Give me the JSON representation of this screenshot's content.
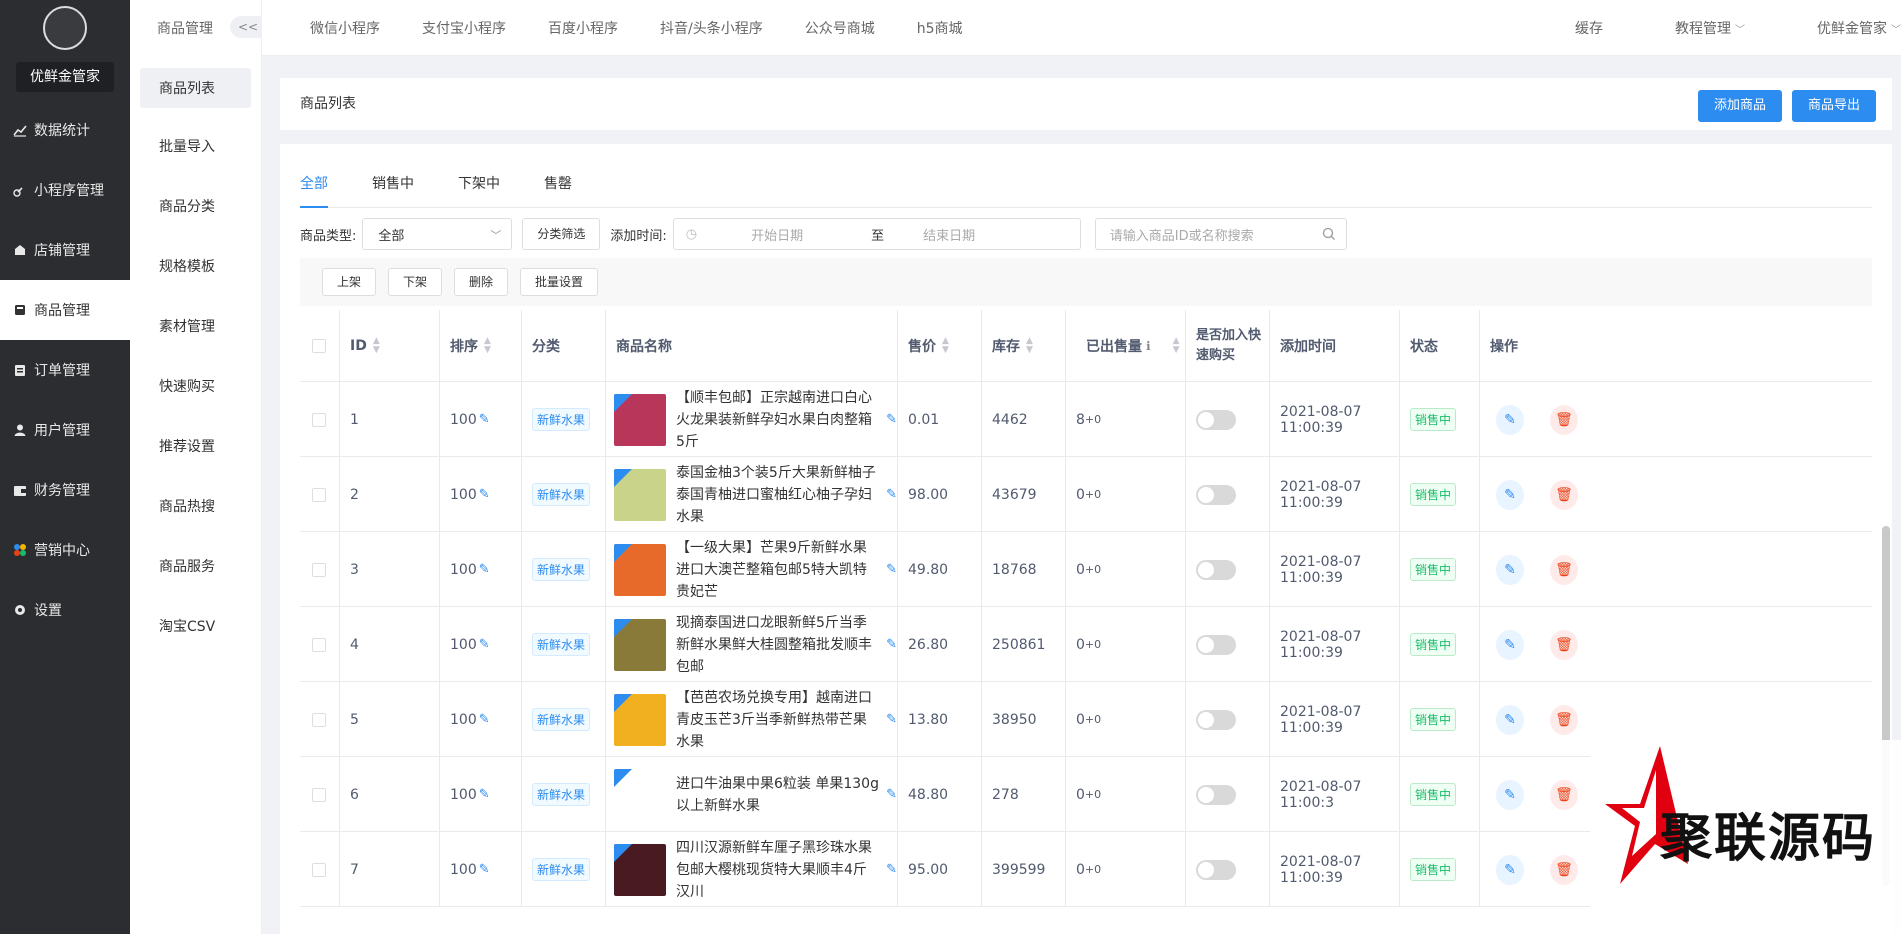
{
  "sidebar": {
    "brand": "优鲜金管家",
    "items": [
      {
        "icon": "chart-line-icon",
        "label": "数据统计"
      },
      {
        "icon": "link-icon",
        "label": "小程序管理"
      },
      {
        "icon": "store-icon",
        "label": "店铺管理"
      },
      {
        "icon": "box-icon",
        "label": "商品管理"
      },
      {
        "icon": "clipboard-icon",
        "label": "订单管理"
      },
      {
        "icon": "user-icon",
        "label": "用户管理"
      },
      {
        "icon": "wallet-icon",
        "label": "财务管理"
      },
      {
        "icon": "marketing-icon",
        "label": "营销中心"
      },
      {
        "icon": "gear-icon",
        "label": "设置"
      }
    ]
  },
  "subsidebar": {
    "title": "商品管理",
    "collapse_label": "<<",
    "items": [
      "商品列表",
      "批量导入",
      "商品分类",
      "规格模板",
      "素材管理",
      "快速购买",
      "推荐设置",
      "商品热搜",
      "商品服务",
      "淘宝CSV"
    ]
  },
  "topbar": {
    "tabs": [
      "微信小程序",
      "支付宝小程序",
      "百度小程序",
      "抖音/头条小程序",
      "公众号商城",
      "h5商城"
    ],
    "right": {
      "cache": "缓存",
      "tutorial": "教程管理",
      "user": "优鲜金管家"
    }
  },
  "header": {
    "title": "商品列表",
    "add_label": "添加商品",
    "export_label": "商品导出"
  },
  "tabs": [
    "全部",
    "销售中",
    "下架中",
    "售罄"
  ],
  "filters": {
    "type_label": "商品类型:",
    "type_value": "全部",
    "category_filter": "分类筛选",
    "time_label": "添加时间:",
    "start_placeholder": "开始日期",
    "to": "至",
    "end_placeholder": "结束日期",
    "search_placeholder": "请输入商品ID或名称搜索"
  },
  "batch": [
    "上架",
    "下架",
    "删除",
    "批量设置"
  ],
  "table": {
    "columns": [
      "ID",
      "排序",
      "分类",
      "商品名称",
      "售价",
      "库存",
      "已出售量",
      "是否加入快速购买",
      "添加时间",
      "状态",
      "操作"
    ],
    "rows": [
      {
        "id": "1",
        "sort": "100",
        "category": "新鲜水果",
        "name": "【顺丰包邮】正宗越南进口白心火龙果装新鲜孕妇水果白肉整箱5斤",
        "price": "0.01",
        "stock": "4462",
        "sold": "8",
        "sold_extra": "+0",
        "time": "2021-08-07 11:00:39",
        "status": "销售中",
        "thumb": "#b8365a"
      },
      {
        "id": "2",
        "sort": "100",
        "category": "新鲜水果",
        "name": "泰国金柚3个装5斤大果新鲜柚子泰国青柚进口蜜柚红心柚子孕妇水果",
        "price": "98.00",
        "stock": "43679",
        "sold": "0",
        "sold_extra": "+0",
        "time": "2021-08-07 11:00:39",
        "status": "销售中",
        "thumb": "#c9d48a"
      },
      {
        "id": "3",
        "sort": "100",
        "category": "新鲜水果",
        "name": "【一级大果】芒果9斤新鲜水果进口大澳芒整箱包邮5特大凯特贵妃芒",
        "price": "49.80",
        "stock": "18768",
        "sold": "0",
        "sold_extra": "+0",
        "time": "2021-08-07 11:00:39",
        "status": "销售中",
        "thumb": "#e86a2a"
      },
      {
        "id": "4",
        "sort": "100",
        "category": "新鲜水果",
        "name": "现摘泰国进口龙眼新鲜5斤当季新鲜水果鲜大桂圆整箱批发顺丰包邮",
        "price": "26.80",
        "stock": "250861",
        "sold": "0",
        "sold_extra": "+0",
        "time": "2021-08-07 11:00:39",
        "status": "销售中",
        "thumb": "#8a7a3a"
      },
      {
        "id": "5",
        "sort": "100",
        "category": "新鲜水果",
        "name": "【芭芭农场兑换专用】越南进口青皮玉芒3斤当季新鲜热带芒果水果",
        "price": "13.80",
        "stock": "38950",
        "sold": "0",
        "sold_extra": "+0",
        "time": "2021-08-07 11:00:39",
        "status": "销售中",
        "thumb": "#f0b020"
      },
      {
        "id": "6",
        "sort": "100",
        "category": "新鲜水果",
        "name": "进口牛油果中果6粒装 单果130g以上新鲜水果",
        "price": "48.80",
        "stock": "278",
        "sold": "0",
        "sold_extra": "+0",
        "time": "2021-08-07 11:00:3",
        "status": "销售中",
        "thumb": "#ffffff"
      },
      {
        "id": "7",
        "sort": "100",
        "category": "新鲜水果",
        "name": "四川汉源新鲜车厘子黑珍珠水果包邮大樱桃现货特大果顺丰4斤汉川",
        "price": "95.00",
        "stock": "399599",
        "sold": "0",
        "sold_extra": "+0",
        "time": "2021-08-07 11:00:39",
        "status": "销售中",
        "thumb": "#4a1a22"
      }
    ]
  },
  "watermark": "聚联源码",
  "colors": {
    "sidebar_bg": "#2c2d30",
    "primary": "#2d8cf0",
    "success": "#19be6b",
    "danger": "#ed4014"
  }
}
